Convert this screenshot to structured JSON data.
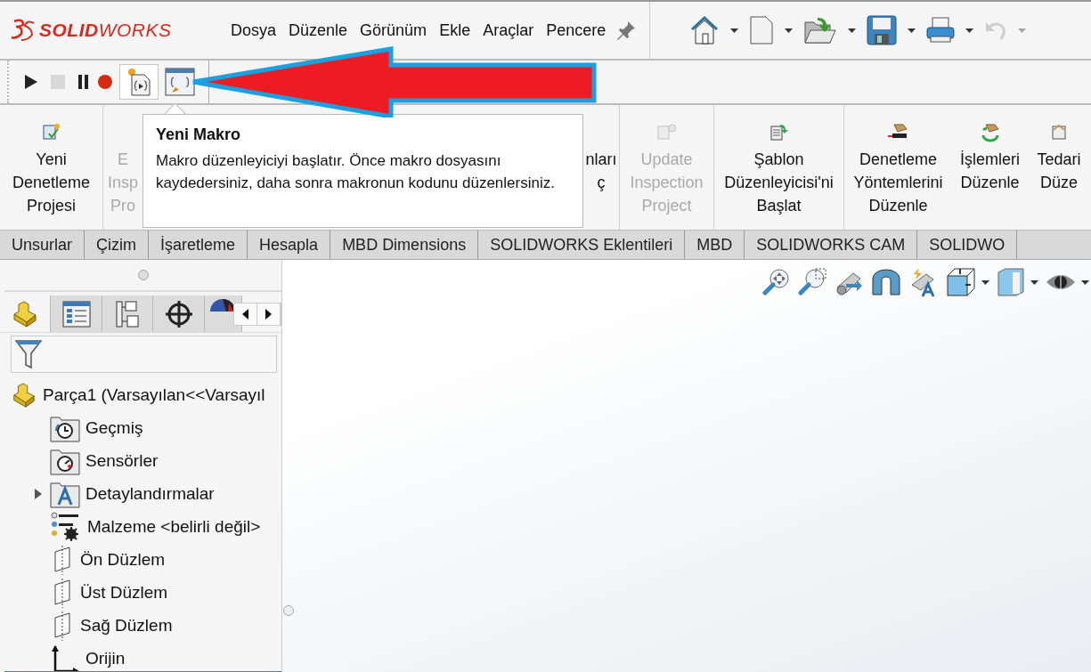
{
  "app": {
    "logo": "**SOLID**WORKS"
  },
  "menu": [
    "Dosya",
    "Düzenle",
    "Görünüm",
    "Ekle",
    "Araçlar",
    "Pencere"
  ],
  "quick_access": [
    {
      "kind": "home",
      "disabled": false
    },
    {
      "kind": "new",
      "disabled": false
    },
    {
      "kind": "open",
      "disabled": false
    },
    {
      "kind": "save",
      "disabled": false
    },
    {
      "kind": "print",
      "disabled": false
    },
    {
      "kind": "undo",
      "disabled": true
    }
  ],
  "macro_toolbar": [
    {
      "kind": "play",
      "disabled": false,
      "selected": false
    },
    {
      "kind": "stop",
      "disabled": true,
      "selected": false
    },
    {
      "kind": "pause",
      "disabled": false,
      "selected": false
    },
    {
      "kind": "record",
      "disabled": false,
      "selected": false
    },
    {
      "kind": "new-macro",
      "disabled": false,
      "selected": true
    },
    {
      "kind": "edit-macro",
      "disabled": false,
      "selected": false
    }
  ],
  "tooltip": {
    "title": "Yeni Makro",
    "text": "Makro düzenleyiciyi başlatır. Önce makro dosyasını kaydedersiniz, daha sonra makronun kodunu düzenlersiniz."
  },
  "ribbon": [
    {
      "kind": "new-project",
      "label": "Yeni\nDenetleme\nProjesi",
      "disabled": false
    },
    {
      "kind": "hidden",
      "label": "E\nInsp\nPro",
      "disabled": true
    },
    {
      "kind": "hidden",
      "label": "nları\nç",
      "disabled": false
    },
    {
      "kind": "update",
      "label": "Update\nInspection\nProject",
      "disabled": true
    },
    {
      "kind": "template",
      "label": "Şablon\nDüzenleyicisi'ni\nBaşlat",
      "disabled": false
    },
    {
      "kind": "methods",
      "label": "Denetleme\nYöntemlerini\nDüzenle",
      "disabled": false
    },
    {
      "kind": "operations",
      "label": "İşlemleri\nDüzenle",
      "disabled": false
    },
    {
      "kind": "supplier",
      "label": "Tedari\nDüze",
      "disabled": false
    }
  ],
  "tabs": [
    {
      "label": "Unsurlar",
      "selected": false
    },
    {
      "label": "Çizim",
      "selected": false
    },
    {
      "label": "İşaretleme",
      "selected": false
    },
    {
      "label": "Hesapla",
      "selected": false
    },
    {
      "label": "MBD Dimensions",
      "selected": false
    },
    {
      "label": "SOLIDWORKS Eklentileri",
      "selected": false
    },
    {
      "label": "MBD",
      "selected": false
    },
    {
      "label": "SOLIDWORKS CAM",
      "selected": false
    },
    {
      "label": "SOLIDWO",
      "selected": false
    }
  ],
  "panel_tabs": [
    {
      "kind": "feature-tree",
      "selected": true
    },
    {
      "kind": "property",
      "selected": false
    },
    {
      "kind": "configuration",
      "selected": false
    },
    {
      "kind": "dimxpert",
      "selected": false
    },
    {
      "kind": "appearance",
      "selected": false
    }
  ],
  "tree": {
    "label": "Parça1  (Varsayılan<<Varsayıl",
    "kind": "part",
    "children": [
      {
        "label": "Geçmiş",
        "kind": "history",
        "expandable": false
      },
      {
        "label": "Sensörler",
        "kind": "sensor",
        "expandable": false
      },
      {
        "label": "Detaylandırmalar",
        "kind": "annotation",
        "expandable": true,
        "expanded": false
      },
      {
        "label": "Malzeme <belirli değil>",
        "kind": "material",
        "expandable": false
      },
      {
        "label": "Ön Düzlem",
        "kind": "plane",
        "expandable": false
      },
      {
        "label": "Üst Düzlem",
        "kind": "plane",
        "expandable": false
      },
      {
        "label": "Sağ Düzlem",
        "kind": "plane",
        "expandable": false
      },
      {
        "label": "Orijin",
        "kind": "origin",
        "expandable": false
      }
    ]
  }
}
